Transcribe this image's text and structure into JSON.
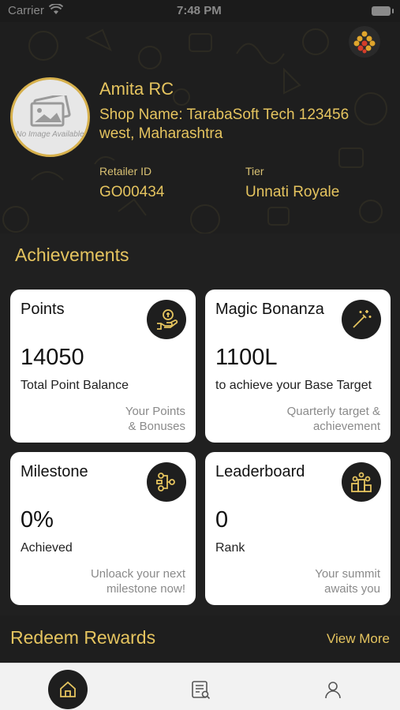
{
  "status": {
    "carrier": "Carrier",
    "time": "7:48 PM"
  },
  "profile": {
    "avatar_placeholder": "No Image Available",
    "name": "Amita RC",
    "shop_line1": "Shop Name: TarabaSoft Tech 123456",
    "shop_line2": "west, Maharashtra",
    "retailer_id_label": "Retailer ID",
    "retailer_id": "GO00434",
    "tier_label": "Tier",
    "tier": "Unnati Royale"
  },
  "achievements": {
    "title": "Achievements",
    "cards": [
      {
        "title": "Points",
        "icon": "hand-coin-icon",
        "value": "14050",
        "subtitle": "Total Point Balance",
        "note1": "Your Points",
        "note2": "& Bonuses"
      },
      {
        "title": "Magic Bonanza",
        "icon": "magic-wand-icon",
        "value": "1100L",
        "subtitle": "to achieve your Base Target",
        "note1": "Quarterly target &",
        "note2": "achievement"
      },
      {
        "title": "Milestone",
        "icon": "milestone-network-icon",
        "value": "0%",
        "subtitle": "Achieved",
        "note1": "Unloack your next",
        "note2": "milestone now!"
      },
      {
        "title": "Leaderboard",
        "icon": "leaderboard-podium-icon",
        "value": "0",
        "subtitle": "Rank",
        "note1": "Your summit",
        "note2": "awaits you"
      }
    ]
  },
  "redeem": {
    "title": "Redeem Rewards",
    "view_more": "View More"
  },
  "tabbar": {
    "tabs": [
      "home-icon",
      "catalog-icon",
      "profile-icon"
    ]
  },
  "colors": {
    "accent": "#e5c45f",
    "dark": "#1e1e1e",
    "card": "#ffffff"
  }
}
